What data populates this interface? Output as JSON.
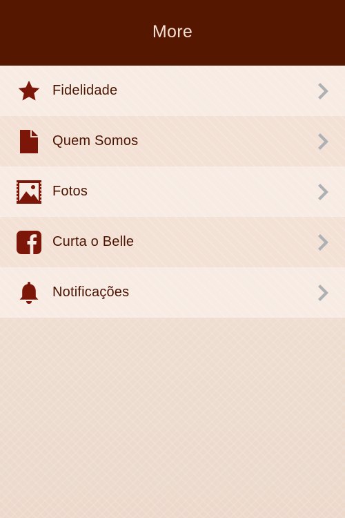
{
  "header": {
    "title": "More"
  },
  "theme": {
    "header_bg": "#561700",
    "icon_color": "#7b1609",
    "chevron_color": "#aeb1b4"
  },
  "menu": {
    "items": [
      {
        "label": "Fidelidade",
        "icon": "star-icon"
      },
      {
        "label": "Quem Somos",
        "icon": "document-icon"
      },
      {
        "label": "Fotos",
        "icon": "photo-icon"
      },
      {
        "label": "Curta o Belle",
        "icon": "facebook-icon"
      },
      {
        "label": "Notificações",
        "icon": "bell-icon"
      }
    ],
    "chevron_icon": "chevron-right-icon"
  }
}
